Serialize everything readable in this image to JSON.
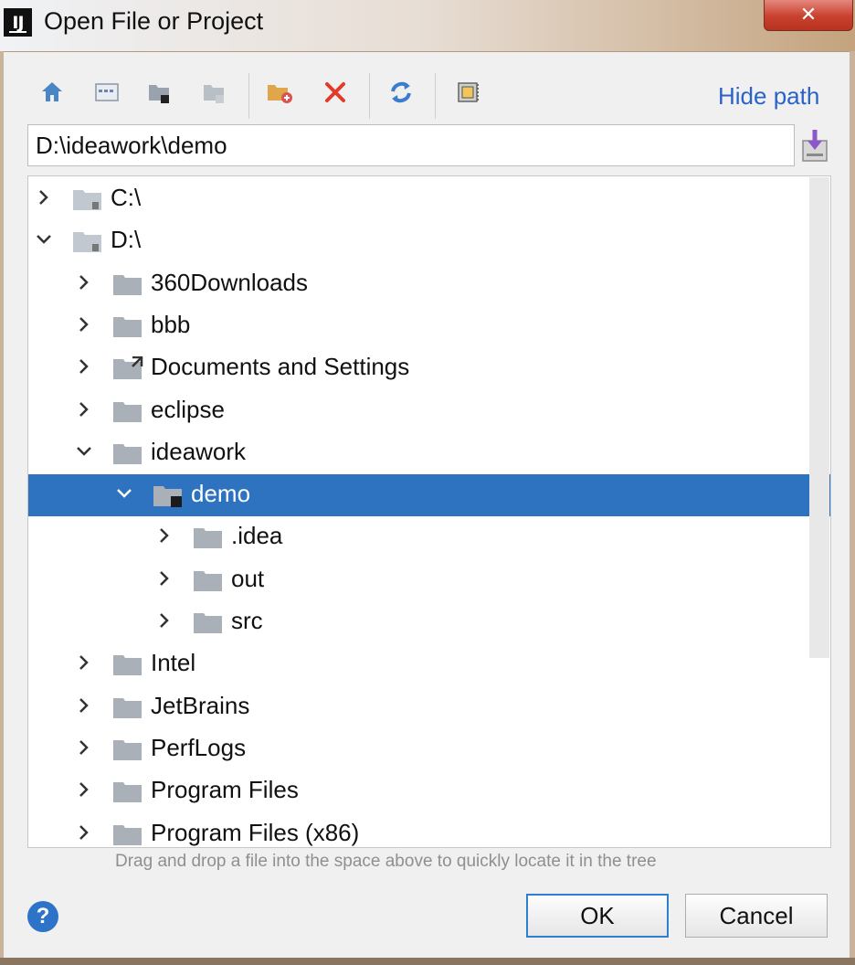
{
  "window": {
    "title": "Open File or Project",
    "app_icon_text": "IJ",
    "close_symbol": "✕"
  },
  "toolbar": {
    "buttons": [
      {
        "name": "home-icon"
      },
      {
        "name": "desktop-icon"
      },
      {
        "name": "project-folder-icon"
      },
      {
        "name": "module-folder-icon"
      },
      {
        "name": "new-folder-icon"
      },
      {
        "name": "delete-icon"
      },
      {
        "name": "refresh-icon"
      },
      {
        "name": "show-hidden-icon"
      }
    ],
    "hide_path_label": "Hide path"
  },
  "path": {
    "value": "D:\\ideawork\\demo"
  },
  "tree": {
    "items": [
      {
        "label": "C:\\",
        "expanded": false,
        "kind": "drive"
      },
      {
        "label": "D:\\",
        "expanded": true,
        "kind": "drive"
      },
      {
        "label": "360Downloads",
        "expanded": false,
        "kind": "folder"
      },
      {
        "label": "bbb",
        "expanded": false,
        "kind": "folder"
      },
      {
        "label": "Documents and Settings",
        "expanded": false,
        "kind": "link-folder"
      },
      {
        "label": "eclipse",
        "expanded": false,
        "kind": "folder"
      },
      {
        "label": "ideawork",
        "expanded": true,
        "kind": "folder"
      },
      {
        "label": "demo",
        "expanded": true,
        "kind": "project-folder",
        "selected": true
      },
      {
        "label": ".idea",
        "expanded": false,
        "kind": "folder"
      },
      {
        "label": "out",
        "expanded": false,
        "kind": "folder"
      },
      {
        "label": "src",
        "expanded": false,
        "kind": "folder"
      },
      {
        "label": "Intel",
        "expanded": false,
        "kind": "folder"
      },
      {
        "label": "JetBrains",
        "expanded": false,
        "kind": "folder"
      },
      {
        "label": "PerfLogs",
        "expanded": false,
        "kind": "folder"
      },
      {
        "label": "Program Files",
        "expanded": false,
        "kind": "folder"
      },
      {
        "label": "Program Files (x86)",
        "expanded": false,
        "kind": "folder"
      }
    ]
  },
  "hint": "Drag and drop a file into the space above to quickly locate it in the tree",
  "footer": {
    "help_symbol": "?",
    "ok_label": "OK",
    "cancel_label": "Cancel"
  },
  "colors": {
    "selection": "#2e73bf",
    "link": "#2a63c8",
    "folder": "#a9b0b8"
  }
}
